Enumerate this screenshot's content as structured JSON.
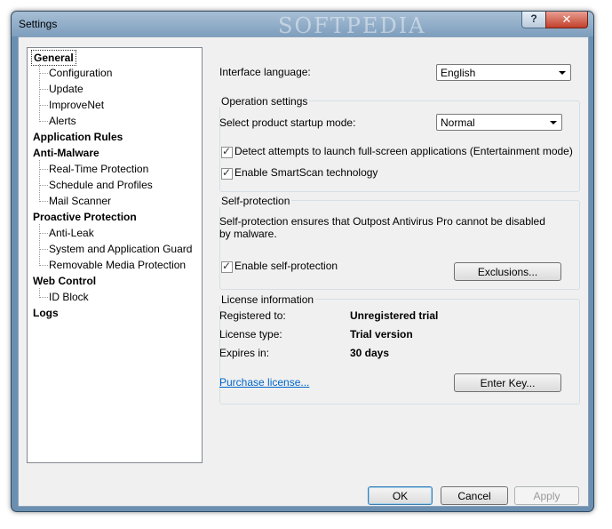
{
  "window": {
    "title": "Settings",
    "watermark": "SOFTPEDIA",
    "help_label": "?",
    "close_label": "✕"
  },
  "tree": [
    {
      "label": "General",
      "level": 0,
      "selected": true
    },
    {
      "label": "Configuration",
      "level": 1
    },
    {
      "label": "Update",
      "level": 1
    },
    {
      "label": "ImproveNet",
      "level": 1
    },
    {
      "label": "Alerts",
      "level": 1
    },
    {
      "label": "Application Rules",
      "level": 0
    },
    {
      "label": "Anti-Malware",
      "level": 0
    },
    {
      "label": "Real-Time Protection",
      "level": 1
    },
    {
      "label": "Schedule and Profiles",
      "level": 1
    },
    {
      "label": "Mail Scanner",
      "level": 1
    },
    {
      "label": "Proactive Protection",
      "level": 0
    },
    {
      "label": "Anti-Leak",
      "level": 1
    },
    {
      "label": "System and Application Guard",
      "level": 1
    },
    {
      "label": "Removable Media Protection",
      "level": 1
    },
    {
      "label": "Web Control",
      "level": 0
    },
    {
      "label": "ID Block",
      "level": 1
    },
    {
      "label": "Logs",
      "level": 0
    }
  ],
  "general": {
    "interface_language_label": "Interface language:",
    "interface_language_value": "English",
    "operation": {
      "title": "Operation settings",
      "startup_mode_label": "Select product startup mode:",
      "startup_mode_value": "Normal",
      "detect_fullscreen_label": "Detect attempts to launch full-screen applications (Entertainment mode)",
      "detect_fullscreen_checked": true,
      "smartscan_label": "Enable SmartScan technology",
      "smartscan_checked": true
    },
    "self_protection": {
      "title": "Self-protection",
      "description": "Self-protection ensures that Outpost Antivirus Pro cannot be disabled by malware.",
      "enable_label": "Enable self-protection",
      "enable_checked": true,
      "exclusions_button": "Exclusions..."
    },
    "license": {
      "title": "License information",
      "registered_label": "Registered to:",
      "registered_value": "Unregistered trial",
      "type_label": "License type:",
      "type_value": "Trial version",
      "expires_label": "Expires in:",
      "expires_value": "30 days",
      "purchase_link": "Purchase license...",
      "enter_key_button": "Enter Key..."
    }
  },
  "footer": {
    "ok": "OK",
    "cancel": "Cancel",
    "apply": "Apply"
  }
}
